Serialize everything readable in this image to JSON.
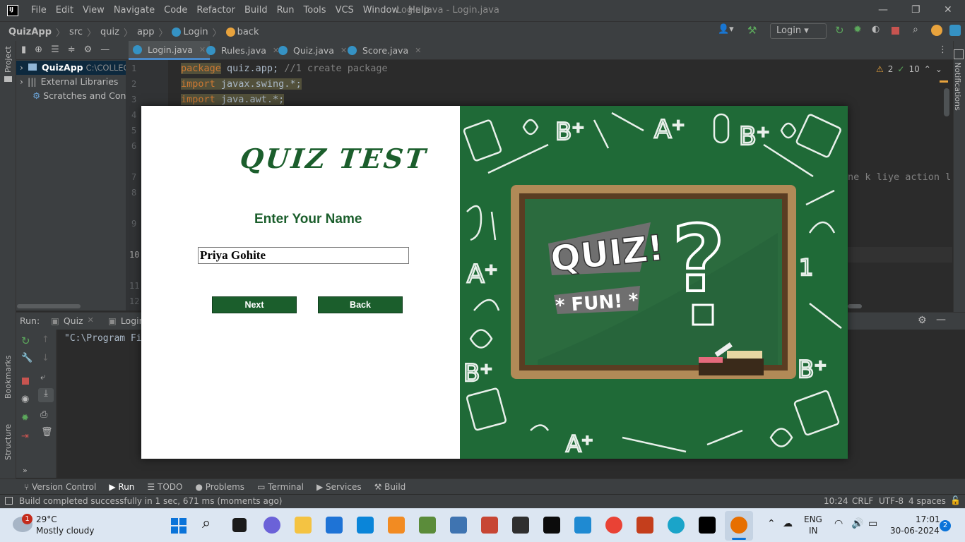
{
  "menubar": {
    "items": [
      "File",
      "Edit",
      "View",
      "Navigate",
      "Code",
      "Refactor",
      "Build",
      "Run",
      "Tools",
      "VCS",
      "Window",
      "Help"
    ],
    "window_title": "Login.java - Login.java"
  },
  "navbar": {
    "crumbs": [
      "QuizApp",
      "src",
      "quiz",
      "app",
      "Login",
      "back"
    ],
    "run_config": "Login"
  },
  "editor_tabs": [
    {
      "label": "Login.java",
      "active": true
    },
    {
      "label": "Rules.java",
      "active": false
    },
    {
      "label": "Quiz.java",
      "active": false
    },
    {
      "label": "Score.java",
      "active": false
    }
  ],
  "sidebar": {
    "project_label": "Project",
    "bookmarks_label": "Bookmarks",
    "structure_label": "Structure",
    "notifications_label": "Notifications"
  },
  "project_tree": {
    "root_name": "QuizApp",
    "root_path": "C:\\COLLEGE",
    "external": "External Libraries",
    "scratches": "Scratches and Consol"
  },
  "code": {
    "line_numbers": [
      "1",
      "2",
      "3",
      "4",
      "5",
      "6",
      "7",
      "8",
      "9",
      "10",
      "11",
      "12"
    ],
    "line1_kw": "package",
    "line1_rest": " quiz.app; ",
    "line1_comment": "//1 create package",
    "line2_kw": "import",
    "line2_rest": " javax.swing.*;",
    "line3_kw": "import",
    "line3_rest": " java.awt.*;",
    "line7_fragment": "ne k liye action l",
    "warnings": "2",
    "weak_warnings": "10"
  },
  "run_panel": {
    "run_label": "Run:",
    "tab1": "Quiz",
    "tab2": "Login",
    "console_text": "\"C:\\Program Fi"
  },
  "bottom_tabs": [
    "Version Control",
    "Run",
    "TODO",
    "Problems",
    "Terminal",
    "Services",
    "Build"
  ],
  "status": {
    "message": "Build completed successfully in 1 sec, 671 ms (moments ago)",
    "position": "10:24",
    "line_sep": "CRLF",
    "encoding": "UTF-8",
    "indent": "4 spaces"
  },
  "taskbar": {
    "temp": "29°C",
    "weather": "Mostly cloudy",
    "weather_badge": "1",
    "lang": "ENG",
    "region": "IN",
    "time": "17:01",
    "date": "30-06-2024",
    "notif_count": "2"
  },
  "dialog": {
    "title": "QUIZ TEST",
    "prompt": "Enter Your Name",
    "name_value": "Priya Gohite",
    "next_label": "Next",
    "back_label": "Back",
    "board_text": "QUIZ!",
    "board_sub": "* FUN! *",
    "board_symbol": "?"
  },
  "colors": {
    "ide_bg": "#2b2b2b",
    "panel_bg": "#3c3f41",
    "quiz_green": "#1b5e2c",
    "board_bg": "#1f6a37"
  }
}
